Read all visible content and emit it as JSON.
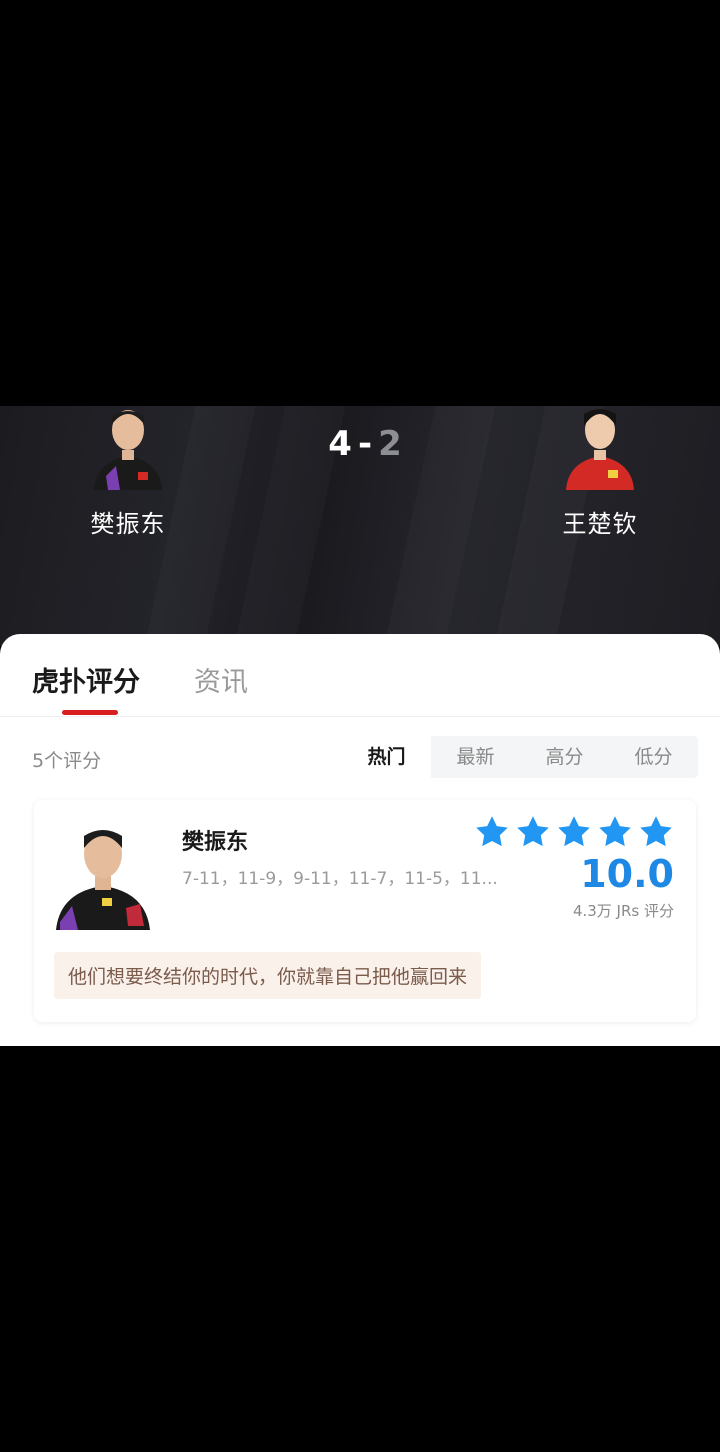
{
  "match": {
    "score_left": "4",
    "score_sep": "-",
    "score_right": "2",
    "player_left": {
      "name": "樊振东",
      "jersey_color": "#1a1a1a"
    },
    "player_right": {
      "name": "王楚钦",
      "jersey_color": "#d42a26"
    }
  },
  "tabs": [
    {
      "label": "虎扑评分",
      "active": true
    },
    {
      "label": "资讯",
      "active": false
    }
  ],
  "ratings": {
    "count_label": "5个评分",
    "sort_options": [
      {
        "label": "热门",
        "active": true
      },
      {
        "label": "最新",
        "active": false
      },
      {
        "label": "高分",
        "active": false
      },
      {
        "label": "低分",
        "active": false
      }
    ]
  },
  "card": {
    "name": "樊振东",
    "scores": "7-11，11-9，9-11，11-7，11-5，11...",
    "stars_filled": 5,
    "rating": "10.0",
    "votes": "4.3万 JRs 评分",
    "comment": "他们想要终结你的时代，你就靠自己把他赢回来"
  },
  "colors": {
    "accent_red": "#d81e1e",
    "rating_blue": "#1e88e5"
  }
}
